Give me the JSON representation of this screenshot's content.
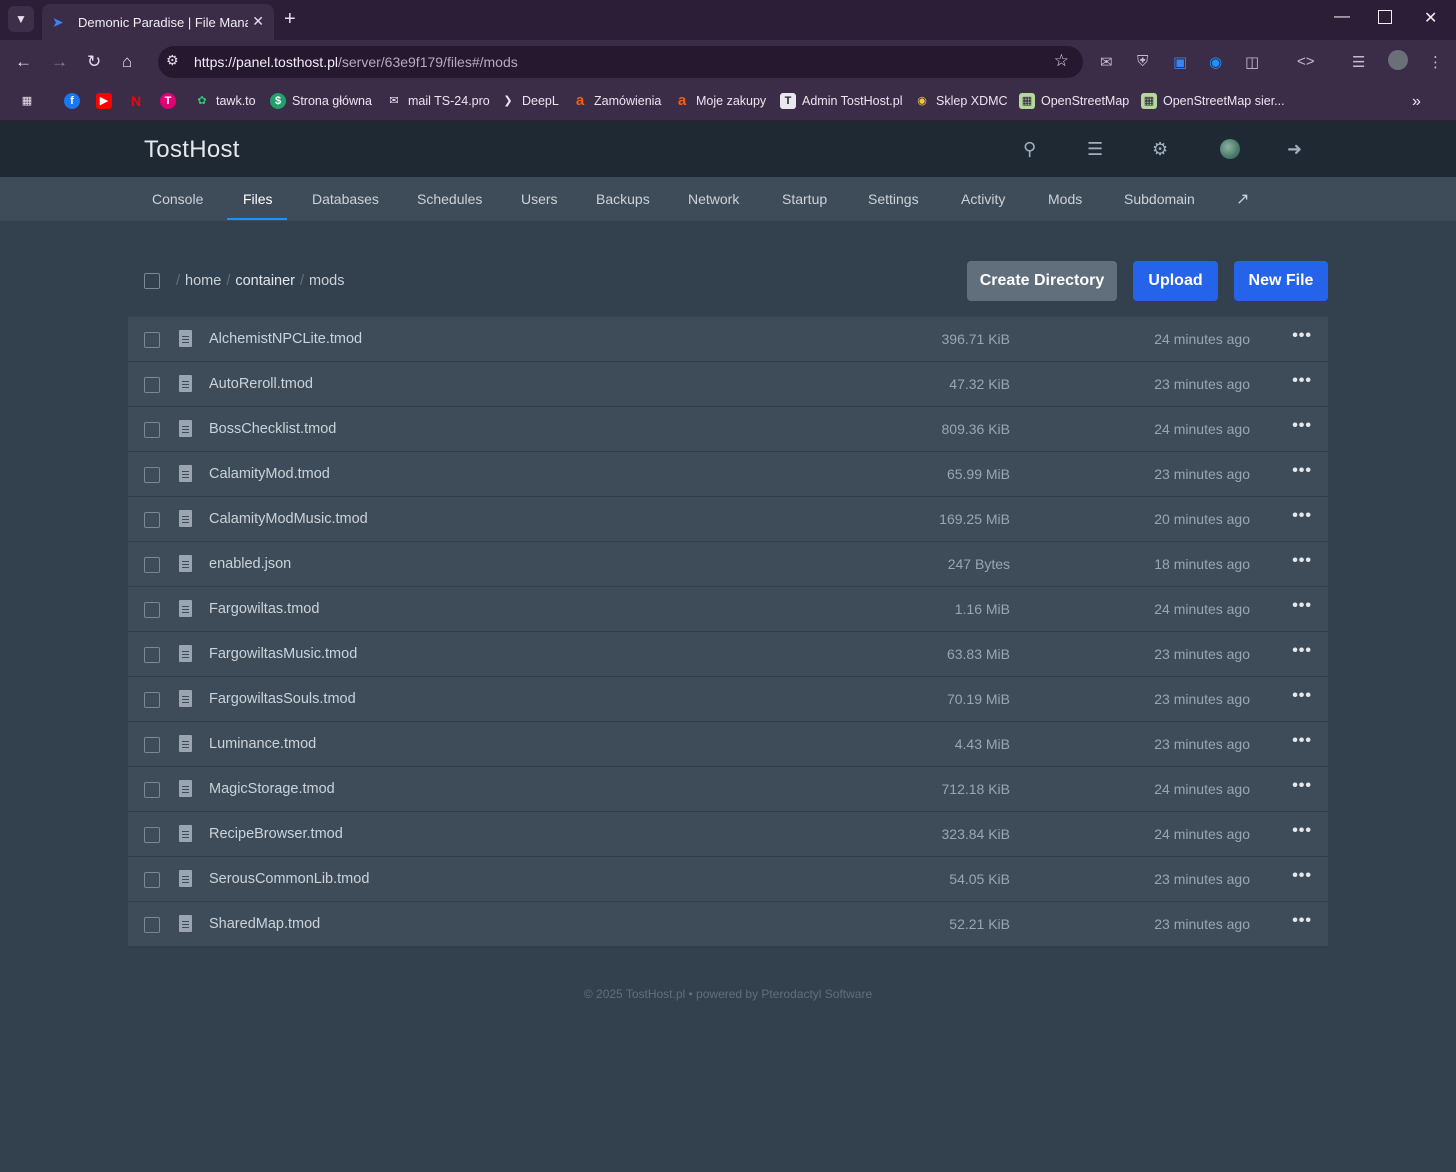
{
  "browser": {
    "tab_title": "Demonic Paradise | File Manager",
    "url_host": "https://panel.tosthost.pl",
    "url_path": "/server/63e9f179/files#/mods",
    "new_tab": "+",
    "bookmarks": [
      {
        "label": "",
        "icon": "apps-icon"
      },
      {
        "label": "",
        "icon": "facebook-icon",
        "color": "#1877f2"
      },
      {
        "label": "",
        "icon": "youtube-icon",
        "color": "#ff0000"
      },
      {
        "label": "",
        "icon": "netflix-icon",
        "color": "#e50914"
      },
      {
        "label": "",
        "icon": "tmobile-icon",
        "color": "#e20074"
      },
      {
        "label": "tawk.to",
        "icon": "tawk-icon"
      },
      {
        "label": "Strona główna",
        "icon": "dollar-icon"
      },
      {
        "label": "mail TS-24.pro",
        "icon": "mail-icon"
      },
      {
        "label": "DeepL",
        "icon": "deepl-icon"
      },
      {
        "label": "Zamówienia",
        "icon": "allegro-icon",
        "color": "#ff5a00"
      },
      {
        "label": "Moje zakupy",
        "icon": "allegro-icon",
        "color": "#ff5a00"
      },
      {
        "label": "Admin TostHost.pl",
        "icon": "tosthost-icon"
      },
      {
        "label": "Sklep XDMC",
        "icon": "xdmc-icon"
      },
      {
        "label": "OpenStreetMap",
        "icon": "osm-icon"
      },
      {
        "label": "OpenStreetMap sier...",
        "icon": "osm-icon"
      }
    ]
  },
  "panel": {
    "brand": "TostHost",
    "tabs": [
      {
        "label": "Console"
      },
      {
        "label": "Files",
        "active": true
      },
      {
        "label": "Databases"
      },
      {
        "label": "Schedules"
      },
      {
        "label": "Users"
      },
      {
        "label": "Backups"
      },
      {
        "label": "Network"
      },
      {
        "label": "Startup"
      },
      {
        "label": "Settings"
      },
      {
        "label": "Activity"
      },
      {
        "label": "Mods"
      },
      {
        "label": "Subdomain"
      }
    ],
    "breadcrumb": [
      "home",
      "container",
      "mods"
    ],
    "buttons": {
      "create_directory": "Create Directory",
      "upload": "Upload",
      "new_file": "New File"
    },
    "files": [
      {
        "name": "AlchemistNPCLite.tmod",
        "size": "396.71 KiB",
        "modified": "24 minutes ago"
      },
      {
        "name": "AutoReroll.tmod",
        "size": "47.32 KiB",
        "modified": "23 minutes ago"
      },
      {
        "name": "BossChecklist.tmod",
        "size": "809.36 KiB",
        "modified": "24 minutes ago"
      },
      {
        "name": "CalamityMod.tmod",
        "size": "65.99 MiB",
        "modified": "23 minutes ago"
      },
      {
        "name": "CalamityModMusic.tmod",
        "size": "169.25 MiB",
        "modified": "20 minutes ago"
      },
      {
        "name": "enabled.json",
        "size": "247 Bytes",
        "modified": "18 minutes ago"
      },
      {
        "name": "Fargowiltas.tmod",
        "size": "1.16 MiB",
        "modified": "24 minutes ago"
      },
      {
        "name": "FargowiltasMusic.tmod",
        "size": "63.83 MiB",
        "modified": "23 minutes ago"
      },
      {
        "name": "FargowiltasSouls.tmod",
        "size": "70.19 MiB",
        "modified": "23 minutes ago"
      },
      {
        "name": "Luminance.tmod",
        "size": "4.43 MiB",
        "modified": "23 minutes ago"
      },
      {
        "name": "MagicStorage.tmod",
        "size": "712.18 KiB",
        "modified": "24 minutes ago"
      },
      {
        "name": "RecipeBrowser.tmod",
        "size": "323.84 KiB",
        "modified": "24 minutes ago"
      },
      {
        "name": "SerousCommonLib.tmod",
        "size": "54.05 KiB",
        "modified": "23 minutes ago"
      },
      {
        "name": "SharedMap.tmod",
        "size": "52.21 KiB",
        "modified": "23 minutes ago"
      }
    ],
    "row_menu": "•••",
    "footer": "© 2025  TostHost.pl • powered by Pterodactyl Software"
  },
  "colors": {
    "accent": "#2563eb",
    "header_bg": "#1f2933",
    "page_bg": "#33404d",
    "row_bg": "#3e4c59"
  }
}
